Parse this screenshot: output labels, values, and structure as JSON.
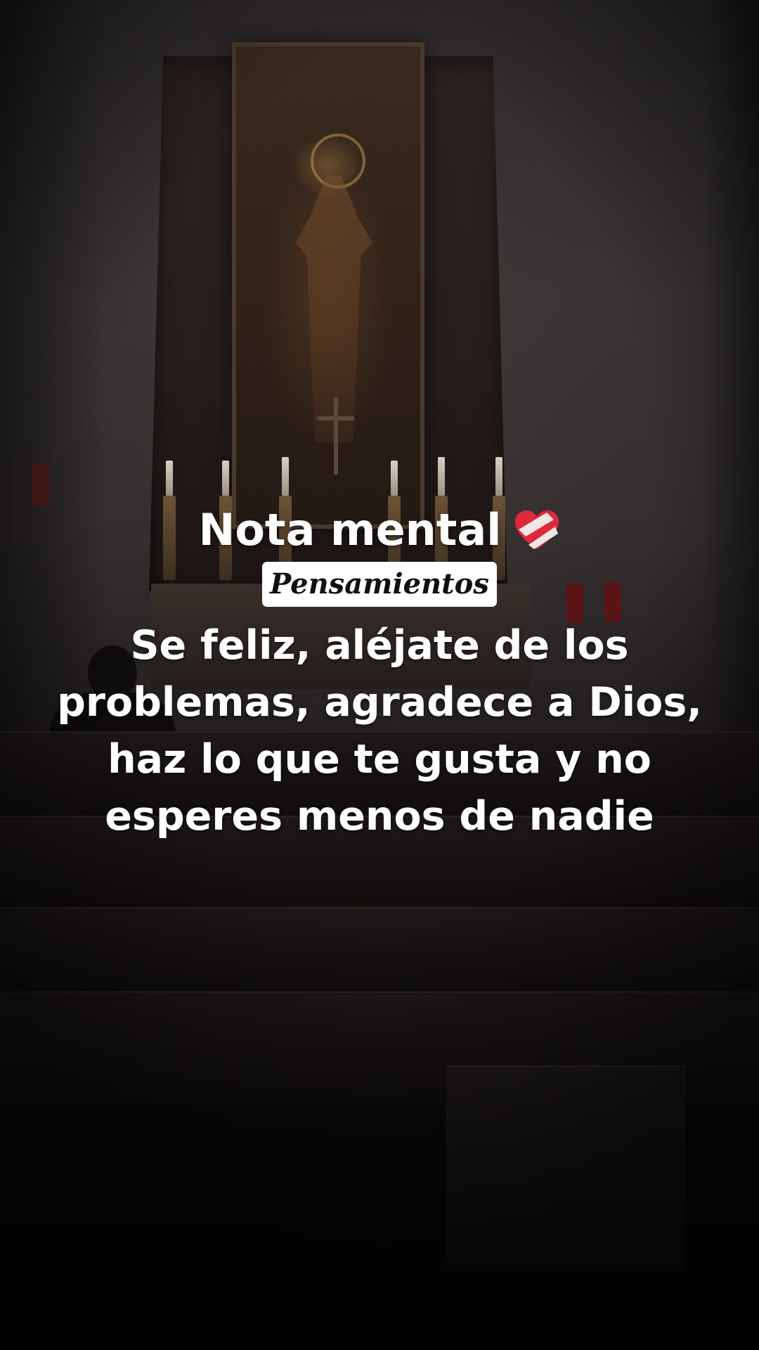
{
  "overlay": {
    "title": "Nota mental",
    "title_icon": "mending-heart-icon",
    "tag": "Pensamientos",
    "quote_lines": [
      "Se feliz, aléjate de los",
      "problemas, agradece a Dios,",
      "haz lo que te gusta y no",
      "esperes menos de nadie"
    ]
  },
  "colors": {
    "text": "#ffffff",
    "tag_background": "#ffffff",
    "tag_text": "#111111",
    "heart": "#e0283c",
    "bandage": "#f3f1ee"
  }
}
